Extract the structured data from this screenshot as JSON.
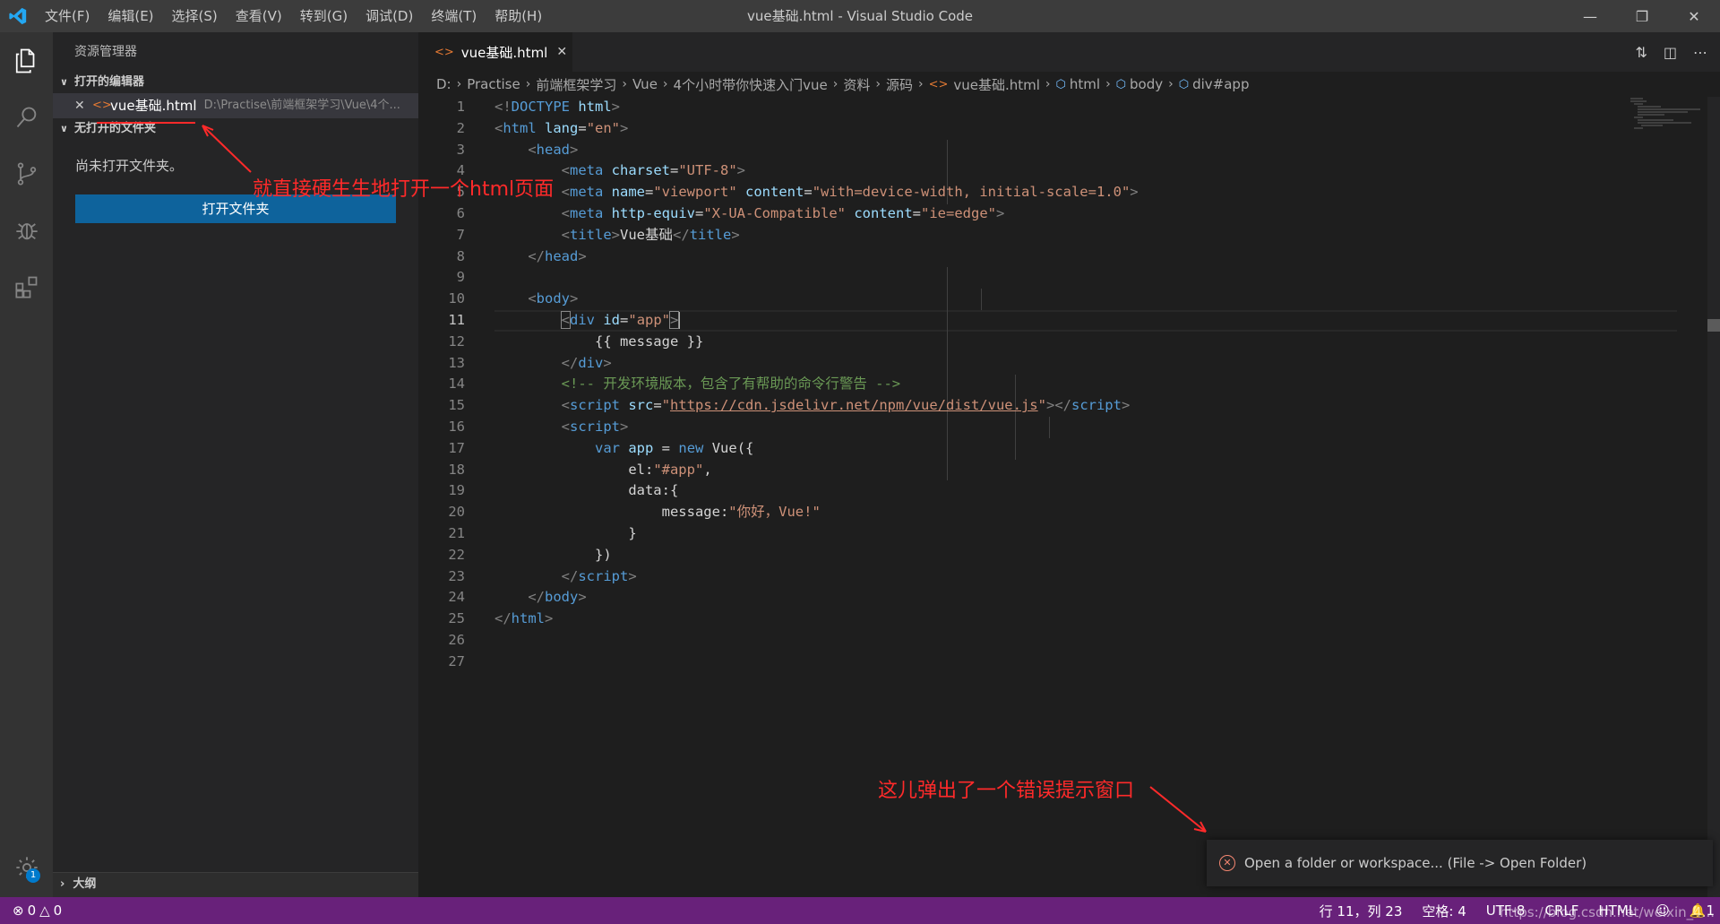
{
  "window": {
    "title": "vue基础.html - Visual Studio Code",
    "menu": [
      "文件(F)",
      "编辑(E)",
      "选择(S)",
      "查看(V)",
      "转到(G)",
      "调试(D)",
      "终端(T)",
      "帮助(H)"
    ]
  },
  "sidebar": {
    "title": "资源管理器",
    "open_editors_label": "打开的编辑器",
    "open_editor": {
      "name": "vue基础.html",
      "path": "D:\\Practise\\前端框架学习\\Vue\\4个..."
    },
    "no_folder_section": "无打开的文件夹",
    "no_folder_text": "尚未打开文件夹。",
    "open_folder_button": "打开文件夹",
    "outline_label": "大纲",
    "settings_badge": "1"
  },
  "editor": {
    "tab_label": "vue基础.html",
    "breadcrumb": [
      "D:",
      "Practise",
      "前端框架学习",
      "Vue",
      "4个小时带你快速入门vue",
      "资料",
      "源码",
      "vue基础.html",
      "html",
      "body",
      "div#app"
    ],
    "current_line": 11,
    "line_numbers": [
      "1",
      "2",
      "3",
      "4",
      "5",
      "6",
      "7",
      "8",
      "9",
      "10",
      "11",
      "12",
      "13",
      "14",
      "15",
      "16",
      "17",
      "18",
      "19",
      "20",
      "21",
      "22",
      "23",
      "24",
      "25",
      "26",
      "27"
    ]
  },
  "annotations": {
    "top": "就直接硬生生地打开一个html页面",
    "bottom": "这儿弹出了一个错误提示窗口",
    "color": "#ff2a2a"
  },
  "notification": {
    "message": "Open a folder or workspace... (File -> Open Folder)"
  },
  "statusbar": {
    "errors": "0",
    "warnings": "0",
    "position": "行 11，列 23",
    "spaces": "空格: 4",
    "encoding": "UTF-8",
    "eol": "CRLF",
    "language": "HTML",
    "bell": "1",
    "watermark": "https://blog.csdn.net/weixin_4...",
    "color": "#68217a"
  }
}
